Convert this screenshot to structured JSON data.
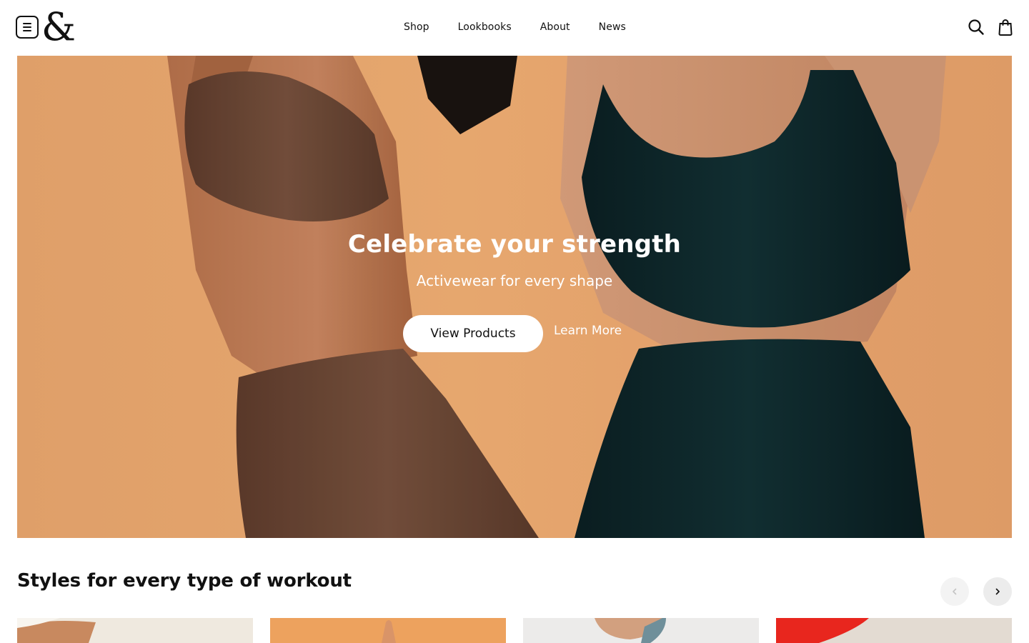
{
  "brand": {
    "logo_text": "&"
  },
  "header": {
    "nav": [
      "Shop",
      "Lookbooks",
      "About",
      "News"
    ],
    "icons": {
      "menu": "menu-icon",
      "search": "search-icon",
      "cart": "bag-icon"
    }
  },
  "hero": {
    "title": "Celebrate your strength",
    "subtitle": "Activewear for every shape",
    "primary_cta": "View Products",
    "secondary_cta": "Learn More",
    "colors": {
      "background": "#eda770",
      "left_garment": "#6d4836",
      "right_garment": "#0d2428"
    }
  },
  "section": {
    "title": "Styles for every type of workout",
    "icons": {
      "prev": "chevron-left-icon",
      "next": "chevron-right-icon"
    }
  },
  "cards": [
    {
      "name": "card-1",
      "color": "#efe9df"
    },
    {
      "name": "card-2",
      "color": "#eda25e"
    },
    {
      "name": "card-3",
      "color": "#ecebea"
    },
    {
      "name": "card-4",
      "color": "#e3dbd2"
    }
  ]
}
